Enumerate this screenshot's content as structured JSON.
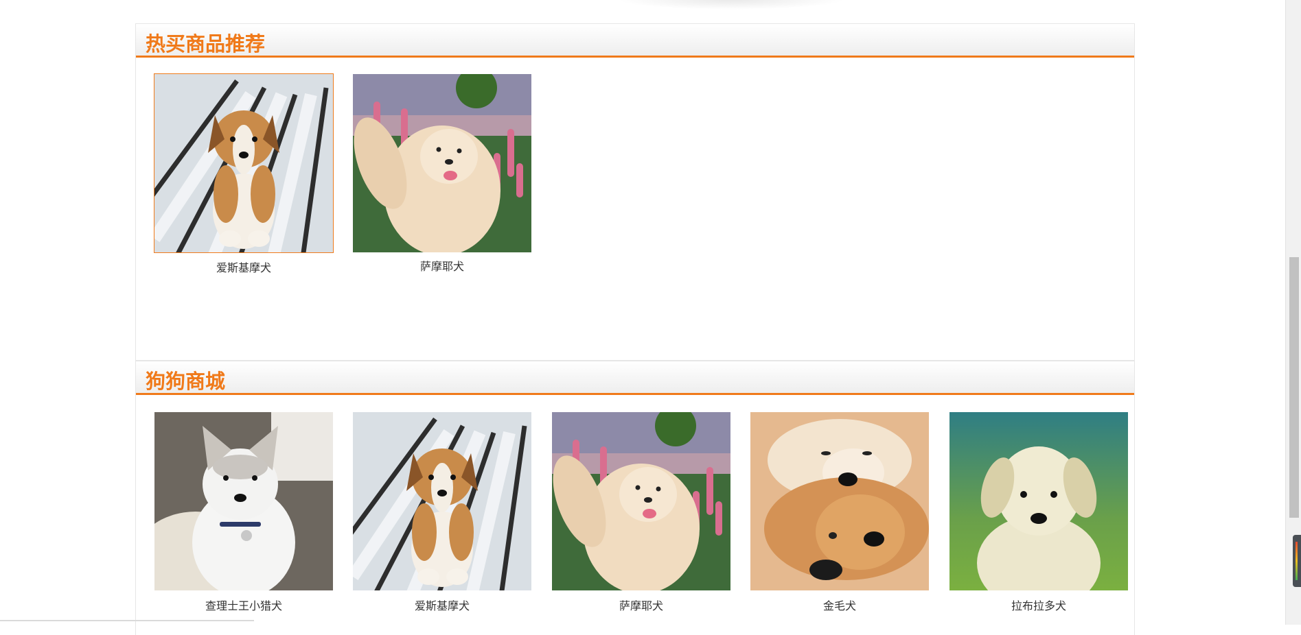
{
  "sections": [
    {
      "title": "热买商品推荐",
      "products": [
        {
          "name": "爱斯基摩犬",
          "image": "corgi-puppy-photo"
        },
        {
          "name": "萨摩耶犬",
          "image": "samoyed-flowers-photo"
        }
      ]
    },
    {
      "title": "狗狗商城",
      "products": [
        {
          "name": "查理士王小猎犬",
          "image": "husky-puppy-photo"
        },
        {
          "name": "爱斯基摩犬",
          "image": "corgi-puppy-photo"
        },
        {
          "name": "萨摩耶犬",
          "image": "samoyed-flowers-photo"
        },
        {
          "name": "金毛犬",
          "image": "golden-retrievers-photo"
        },
        {
          "name": "拉布拉多犬",
          "image": "labrador-puppy-photo"
        }
      ]
    }
  ],
  "colors": {
    "accent": "#f07a1a",
    "text": "#333333",
    "border": "#e6e6e6"
  }
}
